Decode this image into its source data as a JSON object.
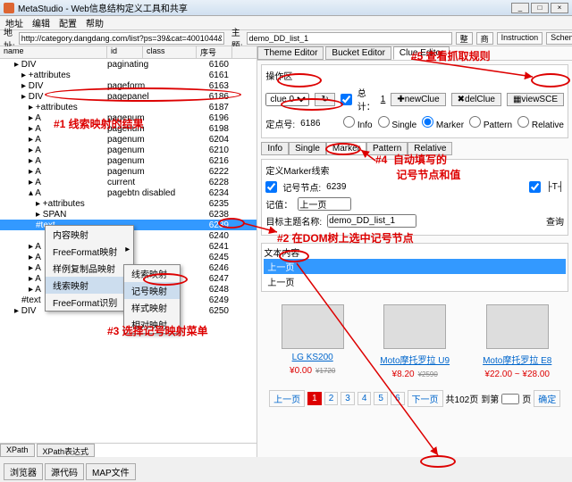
{
  "window": {
    "title": "MetaStudio - Web信息结构定义工具和共享"
  },
  "menu": [
    "地址",
    "编辑",
    "配置",
    "帮助"
  ],
  "address": {
    "label": "地址:",
    "url": "http://category.dangdang.com/list?ps=39&cat=4001044&highp=&lowp"
  },
  "toolbar": {
    "theme": "主题:",
    "theme_val": "demo_DD_list_1",
    "mgr": "整理器",
    "goods": "商品",
    "instr": "Instruction",
    "schema": "Schema"
  },
  "treehdr": {
    "name": "name",
    "id": "id",
    "class": "class",
    "seq": "序号"
  },
  "tree": [
    {
      "ind": 2,
      "n": "▸ DIV",
      "c": "paginating",
      "s": "6160"
    },
    {
      "ind": 3,
      "n": "▸ +attributes",
      "c": "",
      "s": "6161"
    },
    {
      "ind": 3,
      "n": "▸ DIV",
      "c": "pageform",
      "s": "6163"
    },
    {
      "ind": 3,
      "n": "▸ DIV",
      "c": "pagepanel",
      "s": "6186"
    },
    {
      "ind": 4,
      "n": "▸ +attributes",
      "c": "",
      "s": "6187"
    },
    {
      "ind": 4,
      "n": "▸ A",
      "c": "pagenum",
      "s": "6196"
    },
    {
      "ind": 4,
      "n": "▸ A",
      "c": "pagenum",
      "s": "6198"
    },
    {
      "ind": 4,
      "n": "▸ A",
      "c": "pagenum",
      "s": "6204"
    },
    {
      "ind": 4,
      "n": "▸ A",
      "c": "pagenum",
      "s": "6210"
    },
    {
      "ind": 4,
      "n": "▸ A",
      "c": "pagenum",
      "s": "6216"
    },
    {
      "ind": 4,
      "n": "▸ A",
      "c": "pagenum",
      "s": "6222"
    },
    {
      "ind": 4,
      "n": "▸ A",
      "c": "current",
      "s": "6228"
    },
    {
      "ind": 4,
      "n": "▴ A",
      "c": "pagebtn disabled",
      "s": "6234"
    },
    {
      "ind": 5,
      "n": "▸ +attributes",
      "c": "",
      "s": "6235"
    },
    {
      "ind": 5,
      "n": "▸ SPAN",
      "c": "",
      "s": "6238"
    },
    {
      "ind": 5,
      "n": "#text",
      "c": "",
      "s": "6239",
      "sel": true
    },
    {
      "ind": 5,
      "n": "",
      "c": "",
      "s": "6240"
    },
    {
      "ind": 4,
      "n": "▸ A",
      "c": "clear",
      "s": "6241"
    },
    {
      "ind": 4,
      "n": "▸ A",
      "c": "",
      "s": "6245"
    },
    {
      "ind": 4,
      "n": "▸ A",
      "c": "",
      "s": "6246"
    },
    {
      "ind": 4,
      "n": "▸ A",
      "c": "",
      "s": "6247"
    },
    {
      "ind": 4,
      "n": "▸ A",
      "c": "",
      "s": "6248"
    },
    {
      "ind": 3,
      "n": "#text",
      "c": "",
      "s": "6249"
    },
    {
      "ind": 2,
      "n": "▸ DIV",
      "c": "",
      "s": "6250"
    }
  ],
  "ctxmenu": [
    "内容映射",
    "FreeFormat映射",
    "样例复制品映射",
    "线索映射",
    "FreeFormat识别"
  ],
  "submenu": [
    "线索映射",
    "记号映射",
    "样式映射",
    "相对映射"
  ],
  "lefttabs": [
    "XPath",
    "XPath表达式"
  ],
  "rtabs": [
    "Theme Editor",
    "Bucket Editor",
    "Clue Editor"
  ],
  "op": {
    "title": "操作区",
    "clue": "clue 0",
    "total": "总计：",
    "total_n": "1",
    "newclue": "newClue",
    "delclue": "delClue",
    "viewsce": "viewSCE",
    "node": "定点号:",
    "node_v": "6186",
    "info": "Info",
    "single": "Single",
    "marker": "Marker",
    "pattern": "Pattern",
    "relative": "Relative"
  },
  "subtabs": [
    "Info",
    "Single",
    "Marker",
    "Pattern",
    "Relative"
  ],
  "marker": {
    "title": "定义Marker线索",
    "node": "记号节点:",
    "node_v": "6239",
    "val": "记值：",
    "val_v": "上一页",
    "target": "目标主题名称:",
    "target_v": "demo_DD_list_1",
    "query": "查询"
  },
  "textbox": {
    "title": "文本内容",
    "lines": [
      "上一页",
      "上一页"
    ]
  },
  "products": [
    {
      "name": "LG KS200",
      "price": "¥0.00",
      "old": "¥1720"
    },
    {
      "name": "Moto摩托罗拉 U9",
      "price": "¥8.20",
      "old": "¥2590"
    },
    {
      "name": "Moto摩托罗拉 E8",
      "price": "¥22.00 ~ ¥28.00",
      "old": ""
    }
  ],
  "pager": {
    "prev": "上一页",
    "pages": [
      "1",
      "2",
      "3",
      "4",
      "5",
      "6"
    ],
    "next": "下一页",
    "total": "共102页",
    "to": "到第",
    "page": "页",
    "go": "确定"
  },
  "annot": {
    "a1": "#1  线索映射的结果",
    "a2": "#2  在DOM树上选中记号节点",
    "a3": "#3  选择记号映射菜单",
    "a4": "#4  自动填写的\n       记号节点和值",
    "a5": "#5  查看抓取规则"
  }
}
